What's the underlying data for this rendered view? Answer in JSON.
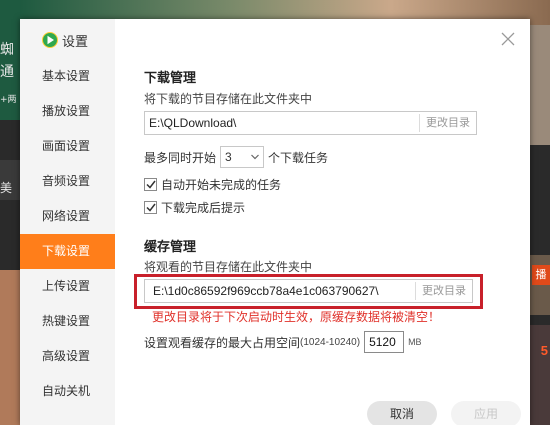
{
  "background": {
    "left_text": [
      "蜘",
      "通",
      "+两",
      "美"
    ],
    "right_badge": "播",
    "right_number": "5"
  },
  "dialog": {
    "title": "设置",
    "logo_icon": "play-logo-icon",
    "close_icon": "close-icon"
  },
  "sidebar": {
    "items": [
      {
        "label": "基本设置",
        "active": false
      },
      {
        "label": "播放设置",
        "active": false
      },
      {
        "label": "画面设置",
        "active": false
      },
      {
        "label": "音频设置",
        "active": false
      },
      {
        "label": "网络设置",
        "active": false
      },
      {
        "label": "下载设置",
        "active": true
      },
      {
        "label": "上传设置",
        "active": false
      },
      {
        "label": "热键设置",
        "active": false
      },
      {
        "label": "高级设置",
        "active": false
      },
      {
        "label": "自动关机",
        "active": false
      }
    ]
  },
  "download": {
    "title": "下载管理",
    "desc": "将下载的节目存储在此文件夹中",
    "path": "E:\\QLDownload\\",
    "change_label": "更改目录",
    "max_prefix": "最多同时开始",
    "max_value": "3",
    "max_suffix": "个下载任务",
    "auto_start_label": "自动开始未完成的任务",
    "auto_start_checked": true,
    "notify_label": "下载完成后提示",
    "notify_checked": true
  },
  "cache": {
    "title": "缓存管理",
    "desc": "将观看的节目存储在此文件夹中",
    "path": "E:\\1d0c86592f969ccb78a4e1c063790627\\",
    "change_label": "更改目录",
    "warning": "更改目录将于下次启动时生效，原缓存数据将被清空！",
    "max_label": "设置观看缓存的最大占用空间",
    "range": "(1024-10240)",
    "max_value": "5120",
    "unit": "MB"
  },
  "buttons": {
    "cancel": "取消",
    "apply": "应用"
  },
  "colors": {
    "accent": "#ff7e1a",
    "highlight_frame": "#c8202a",
    "warning_text": "#e0322b"
  }
}
